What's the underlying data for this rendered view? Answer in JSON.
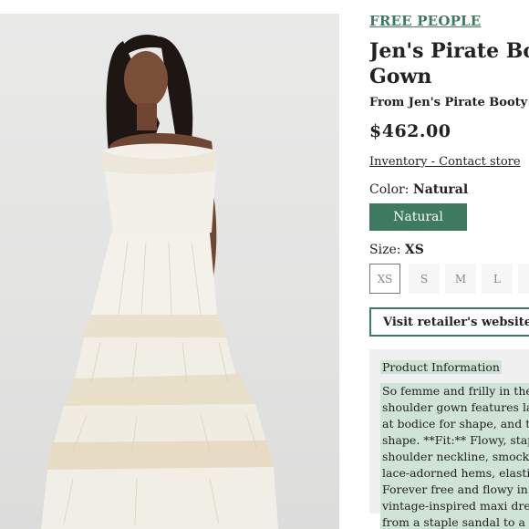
{
  "brand": "FREE PEOPLE",
  "product": {
    "title_line1": "Jen's Pirate Boo",
    "title_line2": "Gown",
    "from": "From Jen's Pirate Booty",
    "price": "$462.00",
    "inventory_link": "Inventory - Contact store"
  },
  "color": {
    "label": "Color:",
    "value": "Natural",
    "option": "Natural",
    "accent": "#3d7a5f"
  },
  "size": {
    "label": "Size:",
    "value": "XS",
    "options": [
      "XS",
      "S",
      "M",
      "L",
      "X"
    ]
  },
  "visit_button": "Visit retailer's website",
  "description": {
    "heading": "Product Information",
    "lines": [
      "So femme and frilly in the mo",
      "shoulder gown features lace o",
      "at bodice for shape, and tiere",
      "shape. **Fit:** Flowy, staple",
      "shoulder neckline, smocked b",
      "lace-adorned hems, elasticate",
      "Forever free and flowy in a su",
      "vintage-inspired maxi dress in",
      "from a staple sandal to a bold"
    ],
    "highlight": "#cfe3d6"
  }
}
